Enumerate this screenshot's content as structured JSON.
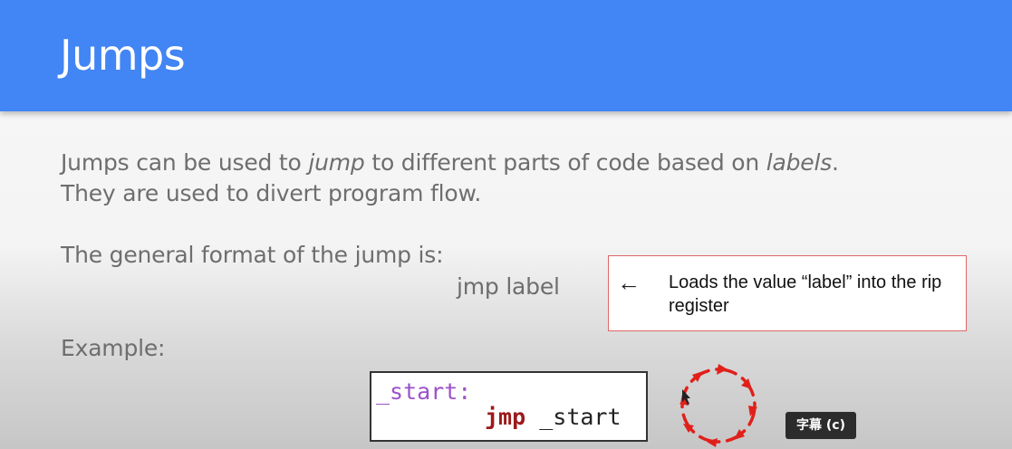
{
  "slide": {
    "title": "Jumps",
    "line1": {
      "before": "Jumps can be used to ",
      "em1": "jump",
      "middle": " to different parts of code based on ",
      "em2": "labels",
      "after": "."
    },
    "line2": "They are used to divert program flow.",
    "line3": "The general format of the jump is:",
    "jmp_syntax": "jmp label",
    "note": {
      "arrow": "←",
      "text": "Loads the value “label” into the rip register"
    },
    "example_label": "Example:",
    "code": {
      "label_line": "_start:",
      "instruction": "jmp",
      "operand": "_start"
    }
  },
  "player": {
    "captions_badge": "字幕 (c)",
    "loading_icon": "spinner-icon",
    "accent_color": "#4285f4",
    "spinner_color": "#e0201a"
  }
}
